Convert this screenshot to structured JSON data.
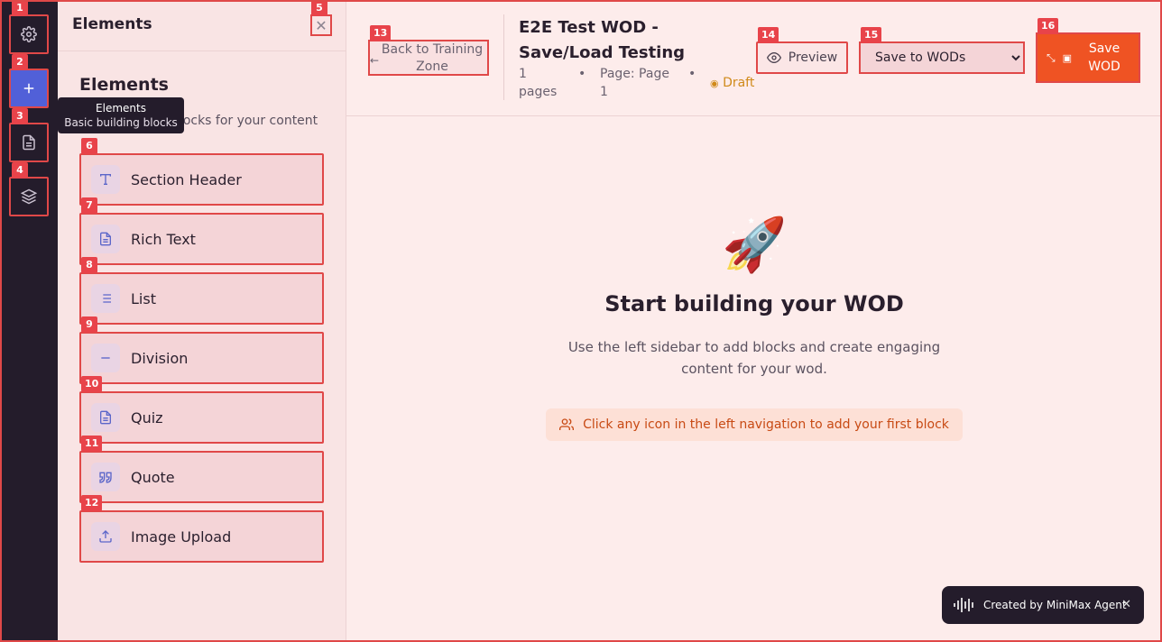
{
  "rail": {
    "badges": [
      "1",
      "2",
      "3",
      "4"
    ]
  },
  "tooltip": {
    "title": "Elements",
    "subtitle": "Basic building blocks"
  },
  "panel": {
    "header": "Elements",
    "close_badge": "5",
    "title": "Elements",
    "subtitle": "Basic building blocks for your content",
    "items": [
      {
        "badge": "6",
        "label": "Section Header",
        "icon": "text-t-icon"
      },
      {
        "badge": "7",
        "label": "Rich Text",
        "icon": "document-icon"
      },
      {
        "badge": "8",
        "label": "List",
        "icon": "list-icon"
      },
      {
        "badge": "9",
        "label": "Division",
        "icon": "minus-icon"
      },
      {
        "badge": "10",
        "label": "Quiz",
        "icon": "document-icon"
      },
      {
        "badge": "11",
        "label": "Quote",
        "icon": "quote-icon"
      },
      {
        "badge": "12",
        "label": "Image Upload",
        "icon": "upload-icon"
      }
    ]
  },
  "header": {
    "back_badge": "13",
    "back_label": "Back to Training Zone",
    "title": "E2E Test WOD - Save/Load Testing",
    "pages": "1 pages",
    "page_label": "Page: Page 1",
    "status": "Draft",
    "preview_badge": "14",
    "preview_label": "Preview",
    "select_badge": "15",
    "select_value": "Save to WODs",
    "save_badge": "16",
    "save_label": "Save WOD"
  },
  "empty": {
    "icon": "🚀",
    "title": "Start building your WOD",
    "subtitle": "Use the left sidebar to add blocks and create engaging content for your wod.",
    "hint": "Click any icon in the left navigation to add your first block"
  },
  "toast": {
    "label": "Created by MiniMax Agent",
    "close": "✕"
  },
  "colors": {
    "accent": "#ef5323",
    "rail": "#241c2b",
    "active": "#5160d8",
    "highlight": "#e04848"
  }
}
